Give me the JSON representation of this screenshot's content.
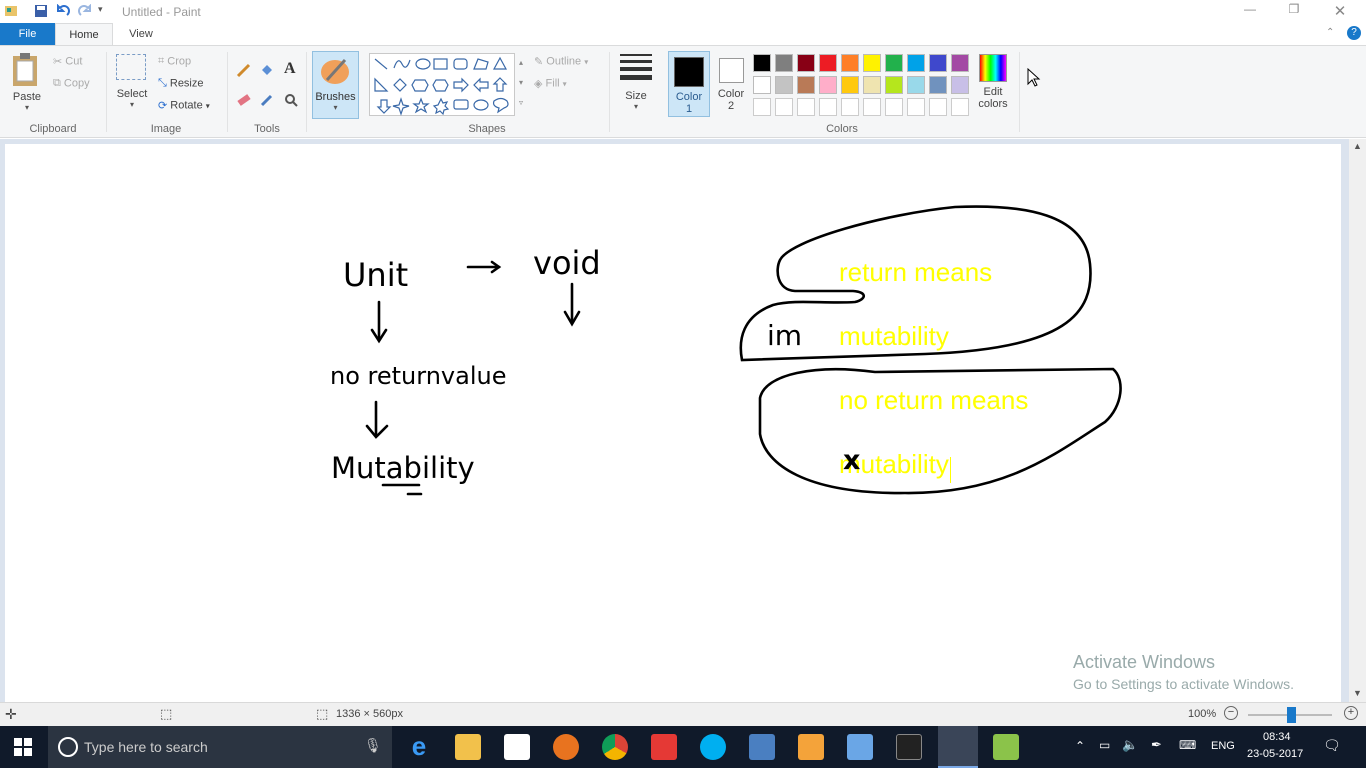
{
  "window": {
    "title": "Untitled - Paint"
  },
  "tabs": {
    "file": "File",
    "home": "Home",
    "view": "View"
  },
  "clipboard": {
    "paste": "Paste",
    "cut": "Cut",
    "copy": "Copy",
    "group": "Clipboard"
  },
  "image": {
    "select": "Select",
    "crop": "Crop",
    "resize": "Resize",
    "rotate": "Rotate",
    "group": "Image"
  },
  "tools": {
    "group": "Tools",
    "brushes": "Brushes"
  },
  "shapes": {
    "outline": "Outline",
    "fill": "Fill",
    "group": "Shapes"
  },
  "size": {
    "label": "Size"
  },
  "colors": {
    "color1": "Color 1",
    "color2": "Color 2",
    "edit": "Edit colors",
    "group": "Colors",
    "row1": [
      "#000000",
      "#7f7f7f",
      "#880015",
      "#ed1c24",
      "#ff7f27",
      "#fff200",
      "#22b14c",
      "#00a2e8",
      "#3f48cc",
      "#a349a4"
    ],
    "row2": [
      "#ffffff",
      "#c3c3c3",
      "#b97a57",
      "#ffaec9",
      "#ffc90e",
      "#efe4b0",
      "#b5e61d",
      "#99d9ea",
      "#7092be",
      "#c8bfe7"
    ]
  },
  "canvas_text": {
    "left_unit": "Unit",
    "left_void": "void",
    "left_noreturn": "no returnvalue",
    "left_mutability": "Mutability",
    "im": "im",
    "top_line1": "return means",
    "top_line2": "mutability",
    "bottom_line1": "no return means",
    "bottom_line2": "mutability"
  },
  "status": {
    "dimensions": "1336 × 560px",
    "zoom": "100%"
  },
  "taskbar": {
    "search_placeholder": "Type here to search",
    "language": "ENG",
    "time": "08:34",
    "date": "23-05-2017"
  },
  "watermark": {
    "line1": "Activate Windows",
    "line2": "Go to Settings to activate Windows."
  }
}
